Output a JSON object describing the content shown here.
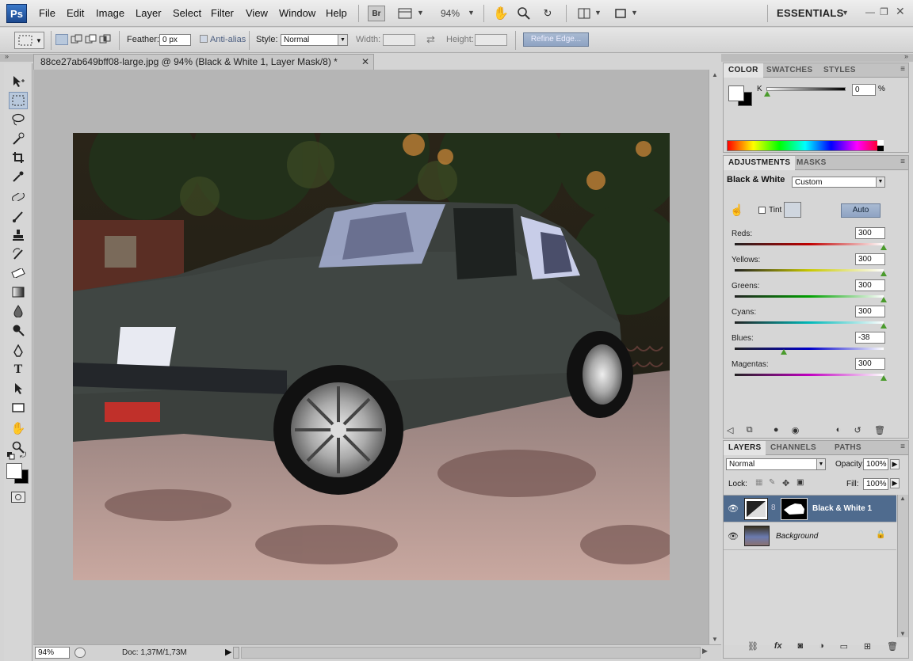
{
  "app": {
    "logo": "Ps"
  },
  "menu": [
    "File",
    "Edit",
    "Image",
    "Layer",
    "Select",
    "Filter",
    "View",
    "Window",
    "Help"
  ],
  "appbar": {
    "bridge_label": "Br",
    "zoom": "94%",
    "workspace": "ESSENTIALS"
  },
  "options": {
    "feather_label": "Feather:",
    "feather_value": "0 px",
    "antialias_label": "Anti-alias",
    "style_label": "Style:",
    "style_value": "Normal",
    "width_label": "Width:",
    "height_label": "Height:",
    "refine_edge_label": "Refine Edge..."
  },
  "document": {
    "tab_title": "88ce27ab649bff08-large.jpg @ 94% (Black & White 1, Layer Mask/8) *",
    "status_zoom": "94%",
    "status_doc": "Doc: 1,37M/1,73M"
  },
  "color_panel": {
    "tabs": [
      "COLOR",
      "SWATCHES",
      "STYLES"
    ],
    "channel_label": "K",
    "value": "0",
    "unit": "%"
  },
  "adjustments_panel": {
    "tabs": [
      "ADJUSTMENTS",
      "MASKS"
    ],
    "title": "Black & White",
    "preset_value": "Custom",
    "tint_label": "Tint",
    "auto_label": "Auto",
    "sliders": [
      {
        "label": "Reds:",
        "value": "300",
        "level": 1.0,
        "color": "#c00000"
      },
      {
        "label": "Yellows:",
        "value": "300",
        "level": 1.0,
        "color": "#c8c800"
      },
      {
        "label": "Greens:",
        "value": "300",
        "level": 1.0,
        "color": "#00a000"
      },
      {
        "label": "Cyans:",
        "value": "300",
        "level": 1.0,
        "color": "#00b8b8"
      },
      {
        "label": "Blues:",
        "value": "-38",
        "level": 0.33,
        "color": "#0000c8"
      },
      {
        "label": "Magentas:",
        "value": "300",
        "level": 1.0,
        "color": "#c000c0"
      }
    ]
  },
  "layers_panel": {
    "tabs": [
      "LAYERS",
      "CHANNELS",
      "PATHS"
    ],
    "blend_mode": "Normal",
    "opacity_label": "Opacity:",
    "opacity_value": "100%",
    "lock_label": "Lock:",
    "fill_label": "Fill:",
    "fill_value": "100%",
    "layers": [
      {
        "name": "Black & White 1",
        "selected": true
      },
      {
        "name": "Background",
        "selected": false
      }
    ]
  },
  "colors": {
    "selection": "#4f6b8e",
    "accent_blue": "#3a78c8"
  }
}
